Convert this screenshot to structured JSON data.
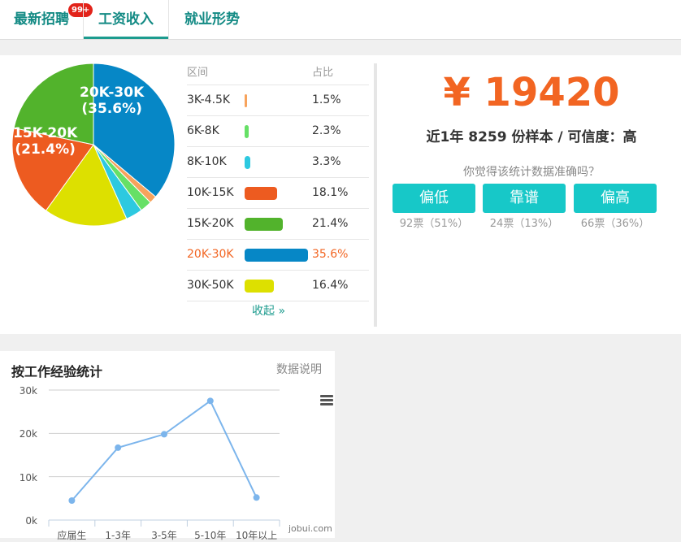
{
  "tabs": [
    {
      "label": "最新招聘",
      "badge": "99+"
    },
    {
      "label": "工资收入"
    },
    {
      "label": "就业形势"
    }
  ],
  "salary_distribution": {
    "header": {
      "range": "区间",
      "ratio": "占比"
    },
    "rows": [
      {
        "range": "3K-4.5K",
        "ratio": "1.5%",
        "value": 1.5,
        "color": "#f7a35c"
      },
      {
        "range": "6K-8K",
        "ratio": "2.3%",
        "value": 2.3,
        "color": "#66e066"
      },
      {
        "range": "8K-10K",
        "ratio": "3.3%",
        "value": 3.3,
        "color": "#2dc9e0"
      },
      {
        "range": "10K-15K",
        "ratio": "18.1%",
        "value": 18.1,
        "color": "#ed5b20"
      },
      {
        "range": "15K-20K",
        "ratio": "21.4%",
        "value": 21.4,
        "color": "#52b32c"
      },
      {
        "range": "20K-30K",
        "ratio": "35.6%",
        "value": 35.6,
        "color": "#0687c6",
        "highlight": true
      },
      {
        "range": "30K-50K",
        "ratio": "16.4%",
        "value": 16.4,
        "color": "#dde000"
      }
    ],
    "collapse": "收起 »",
    "pie_labels": [
      {
        "text1": "20K-30K",
        "text2": "(35.6%)"
      },
      {
        "text1": "15K-20K",
        "text2": "(21.4%)"
      }
    ]
  },
  "summary": {
    "price": "¥ 19420",
    "sample_prefix": "近",
    "sample_year": "1",
    "sample_mid": "年 ",
    "sample_count": "8259",
    "sample_suffix": " 份样本 / 可信度：高",
    "question": "你觉得该统计数据准确吗？",
    "votes": [
      {
        "label": "偏低",
        "count": "92票（51%）"
      },
      {
        "label": "靠谱",
        "count": "24票（13%）"
      },
      {
        "label": "偏高",
        "count": "66票（36%）"
      }
    ]
  },
  "experience_chart": {
    "title": "按工作经验统计",
    "note": "数据说明",
    "credit": "jobui.com",
    "y_ticks": [
      "30k",
      "20k",
      "10k",
      "0k"
    ]
  },
  "chart_data": {
    "type": "line",
    "categories": [
      "应届生",
      "1-3年",
      "3-5年",
      "5-10年",
      "10年以上"
    ],
    "values": [
      4500,
      16700,
      19800,
      27500,
      5200
    ],
    "ylim": [
      0,
      30000
    ],
    "grid": true,
    "color": "#7cb5ec"
  }
}
